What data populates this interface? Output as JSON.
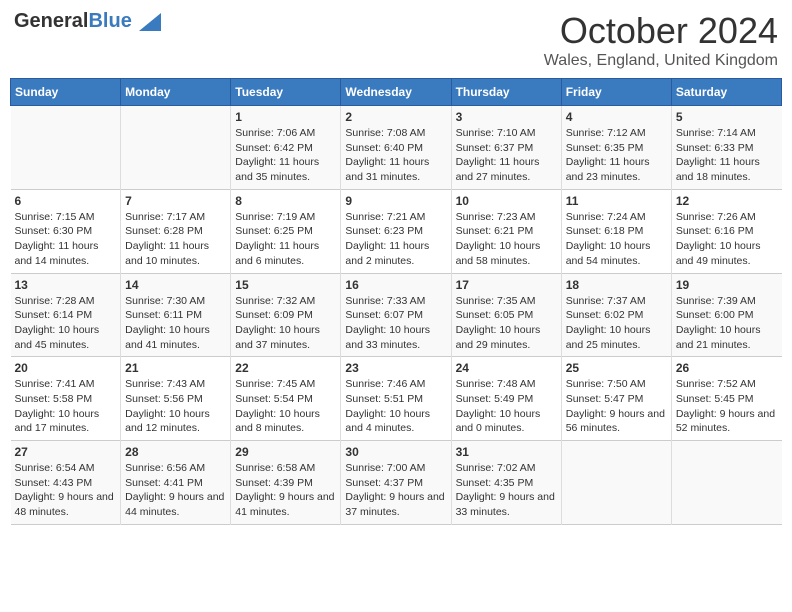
{
  "header": {
    "logo_general": "General",
    "logo_blue": "Blue",
    "month_title": "October 2024",
    "location": "Wales, England, United Kingdom"
  },
  "days_of_week": [
    "Sunday",
    "Monday",
    "Tuesday",
    "Wednesday",
    "Thursday",
    "Friday",
    "Saturday"
  ],
  "weeks": [
    [
      {
        "day": "",
        "sunrise": "",
        "sunset": "",
        "daylight": ""
      },
      {
        "day": "",
        "sunrise": "",
        "sunset": "",
        "daylight": ""
      },
      {
        "day": "1",
        "sunrise": "Sunrise: 7:06 AM",
        "sunset": "Sunset: 6:42 PM",
        "daylight": "Daylight: 11 hours and 35 minutes."
      },
      {
        "day": "2",
        "sunrise": "Sunrise: 7:08 AM",
        "sunset": "Sunset: 6:40 PM",
        "daylight": "Daylight: 11 hours and 31 minutes."
      },
      {
        "day": "3",
        "sunrise": "Sunrise: 7:10 AM",
        "sunset": "Sunset: 6:37 PM",
        "daylight": "Daylight: 11 hours and 27 minutes."
      },
      {
        "day": "4",
        "sunrise": "Sunrise: 7:12 AM",
        "sunset": "Sunset: 6:35 PM",
        "daylight": "Daylight: 11 hours and 23 minutes."
      },
      {
        "day": "5",
        "sunrise": "Sunrise: 7:14 AM",
        "sunset": "Sunset: 6:33 PM",
        "daylight": "Daylight: 11 hours and 18 minutes."
      }
    ],
    [
      {
        "day": "6",
        "sunrise": "Sunrise: 7:15 AM",
        "sunset": "Sunset: 6:30 PM",
        "daylight": "Daylight: 11 hours and 14 minutes."
      },
      {
        "day": "7",
        "sunrise": "Sunrise: 7:17 AM",
        "sunset": "Sunset: 6:28 PM",
        "daylight": "Daylight: 11 hours and 10 minutes."
      },
      {
        "day": "8",
        "sunrise": "Sunrise: 7:19 AM",
        "sunset": "Sunset: 6:25 PM",
        "daylight": "Daylight: 11 hours and 6 minutes."
      },
      {
        "day": "9",
        "sunrise": "Sunrise: 7:21 AM",
        "sunset": "Sunset: 6:23 PM",
        "daylight": "Daylight: 11 hours and 2 minutes."
      },
      {
        "day": "10",
        "sunrise": "Sunrise: 7:23 AM",
        "sunset": "Sunset: 6:21 PM",
        "daylight": "Daylight: 10 hours and 58 minutes."
      },
      {
        "day": "11",
        "sunrise": "Sunrise: 7:24 AM",
        "sunset": "Sunset: 6:18 PM",
        "daylight": "Daylight: 10 hours and 54 minutes."
      },
      {
        "day": "12",
        "sunrise": "Sunrise: 7:26 AM",
        "sunset": "Sunset: 6:16 PM",
        "daylight": "Daylight: 10 hours and 49 minutes."
      }
    ],
    [
      {
        "day": "13",
        "sunrise": "Sunrise: 7:28 AM",
        "sunset": "Sunset: 6:14 PM",
        "daylight": "Daylight: 10 hours and 45 minutes."
      },
      {
        "day": "14",
        "sunrise": "Sunrise: 7:30 AM",
        "sunset": "Sunset: 6:11 PM",
        "daylight": "Daylight: 10 hours and 41 minutes."
      },
      {
        "day": "15",
        "sunrise": "Sunrise: 7:32 AM",
        "sunset": "Sunset: 6:09 PM",
        "daylight": "Daylight: 10 hours and 37 minutes."
      },
      {
        "day": "16",
        "sunrise": "Sunrise: 7:33 AM",
        "sunset": "Sunset: 6:07 PM",
        "daylight": "Daylight: 10 hours and 33 minutes."
      },
      {
        "day": "17",
        "sunrise": "Sunrise: 7:35 AM",
        "sunset": "Sunset: 6:05 PM",
        "daylight": "Daylight: 10 hours and 29 minutes."
      },
      {
        "day": "18",
        "sunrise": "Sunrise: 7:37 AM",
        "sunset": "Sunset: 6:02 PM",
        "daylight": "Daylight: 10 hours and 25 minutes."
      },
      {
        "day": "19",
        "sunrise": "Sunrise: 7:39 AM",
        "sunset": "Sunset: 6:00 PM",
        "daylight": "Daylight: 10 hours and 21 minutes."
      }
    ],
    [
      {
        "day": "20",
        "sunrise": "Sunrise: 7:41 AM",
        "sunset": "Sunset: 5:58 PM",
        "daylight": "Daylight: 10 hours and 17 minutes."
      },
      {
        "day": "21",
        "sunrise": "Sunrise: 7:43 AM",
        "sunset": "Sunset: 5:56 PM",
        "daylight": "Daylight: 10 hours and 12 minutes."
      },
      {
        "day": "22",
        "sunrise": "Sunrise: 7:45 AM",
        "sunset": "Sunset: 5:54 PM",
        "daylight": "Daylight: 10 hours and 8 minutes."
      },
      {
        "day": "23",
        "sunrise": "Sunrise: 7:46 AM",
        "sunset": "Sunset: 5:51 PM",
        "daylight": "Daylight: 10 hours and 4 minutes."
      },
      {
        "day": "24",
        "sunrise": "Sunrise: 7:48 AM",
        "sunset": "Sunset: 5:49 PM",
        "daylight": "Daylight: 10 hours and 0 minutes."
      },
      {
        "day": "25",
        "sunrise": "Sunrise: 7:50 AM",
        "sunset": "Sunset: 5:47 PM",
        "daylight": "Daylight: 9 hours and 56 minutes."
      },
      {
        "day": "26",
        "sunrise": "Sunrise: 7:52 AM",
        "sunset": "Sunset: 5:45 PM",
        "daylight": "Daylight: 9 hours and 52 minutes."
      }
    ],
    [
      {
        "day": "27",
        "sunrise": "Sunrise: 6:54 AM",
        "sunset": "Sunset: 4:43 PM",
        "daylight": "Daylight: 9 hours and 48 minutes."
      },
      {
        "day": "28",
        "sunrise": "Sunrise: 6:56 AM",
        "sunset": "Sunset: 4:41 PM",
        "daylight": "Daylight: 9 hours and 44 minutes."
      },
      {
        "day": "29",
        "sunrise": "Sunrise: 6:58 AM",
        "sunset": "Sunset: 4:39 PM",
        "daylight": "Daylight: 9 hours and 41 minutes."
      },
      {
        "day": "30",
        "sunrise": "Sunrise: 7:00 AM",
        "sunset": "Sunset: 4:37 PM",
        "daylight": "Daylight: 9 hours and 37 minutes."
      },
      {
        "day": "31",
        "sunrise": "Sunrise: 7:02 AM",
        "sunset": "Sunset: 4:35 PM",
        "daylight": "Daylight: 9 hours and 33 minutes."
      },
      {
        "day": "",
        "sunrise": "",
        "sunset": "",
        "daylight": ""
      },
      {
        "day": "",
        "sunrise": "",
        "sunset": "",
        "daylight": ""
      }
    ]
  ]
}
